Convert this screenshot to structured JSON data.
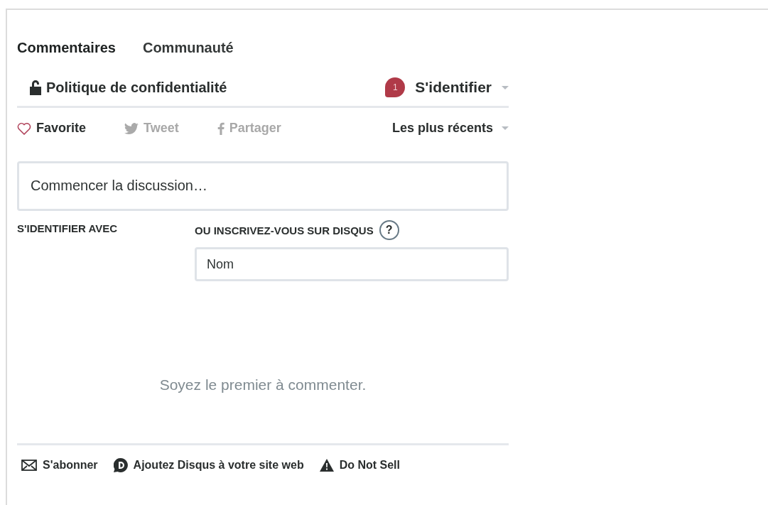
{
  "nav_tabs": [
    {
      "label": "Commentaires",
      "selected": true
    },
    {
      "label": "Communauté",
      "selected": false
    }
  ],
  "privacy_link": "Politique de confidentialité",
  "login": {
    "badge": "1",
    "label": "S'identifier"
  },
  "actions": [
    {
      "kind": "favorite",
      "label": "Favorite",
      "active": true
    },
    {
      "kind": "tweet",
      "label": "Tweet",
      "active": false
    },
    {
      "kind": "share",
      "label": "Partager",
      "active": false
    }
  ],
  "sort": {
    "label": "Les plus récents"
  },
  "composer": {
    "placeholder": "Commencer la discussion…"
  },
  "login_with": "S'IDENTIFIER AVEC",
  "signup": {
    "heading": "OU INSCRIVEZ-VOUS SUR DISQUS",
    "help": "?",
    "name_placeholder": "Nom"
  },
  "empty_message": "Soyez le premier à commenter.",
  "footer": [
    {
      "kind": "mail",
      "label": "S'abonner"
    },
    {
      "kind": "disqus",
      "label": "Ajoutez Disqus à votre site web"
    },
    {
      "kind": "warning",
      "label": "Do Not Sell"
    }
  ]
}
